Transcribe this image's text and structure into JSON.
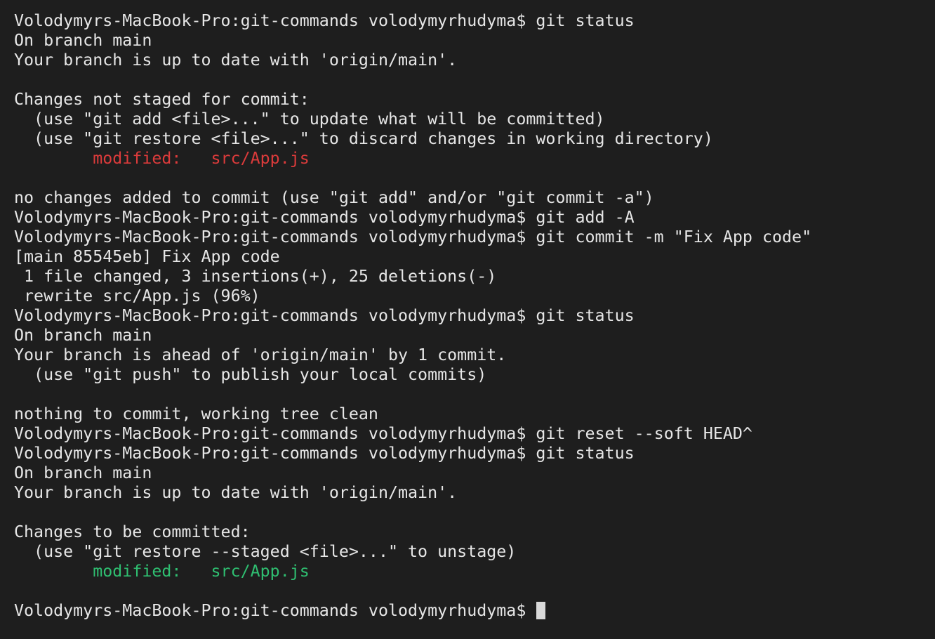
{
  "terminal": {
    "lines": [
      [
        {
          "text": "Volodymyrs-MacBook-Pro:git-commands volodymyrhudyma$ git status"
        }
      ],
      [
        {
          "text": "On branch main"
        }
      ],
      [
        {
          "text": "Your branch is up to date with 'origin/main'."
        }
      ],
      [
        {
          "text": ""
        }
      ],
      [
        {
          "text": "Changes not staged for commit:"
        }
      ],
      [
        {
          "text": "  (use \"git add <file>...\" to update what will be committed)"
        }
      ],
      [
        {
          "text": "  (use \"git restore <file>...\" to discard changes in working directory)"
        }
      ],
      [
        {
          "text": "        "
        },
        {
          "text": "modified:   src/App.js",
          "color": "red"
        }
      ],
      [
        {
          "text": ""
        }
      ],
      [
        {
          "text": "no changes added to commit (use \"git add\" and/or \"git commit -a\")"
        }
      ],
      [
        {
          "text": "Volodymyrs-MacBook-Pro:git-commands volodymyrhudyma$ git add -A"
        }
      ],
      [
        {
          "text": "Volodymyrs-MacBook-Pro:git-commands volodymyrhudyma$ git commit -m \"Fix App code\""
        }
      ],
      [
        {
          "text": "[main 85545eb] Fix App code"
        }
      ],
      [
        {
          "text": " 1 file changed, 3 insertions(+), 25 deletions(-)"
        }
      ],
      [
        {
          "text": " rewrite src/App.js (96%)"
        }
      ],
      [
        {
          "text": "Volodymyrs-MacBook-Pro:git-commands volodymyrhudyma$ git status"
        }
      ],
      [
        {
          "text": "On branch main"
        }
      ],
      [
        {
          "text": "Your branch is ahead of 'origin/main' by 1 commit."
        }
      ],
      [
        {
          "text": "  (use \"git push\" to publish your local commits)"
        }
      ],
      [
        {
          "text": ""
        }
      ],
      [
        {
          "text": "nothing to commit, working tree clean"
        }
      ],
      [
        {
          "text": "Volodymyrs-MacBook-Pro:git-commands volodymyrhudyma$ git reset --soft HEAD^"
        }
      ],
      [
        {
          "text": "Volodymyrs-MacBook-Pro:git-commands volodymyrhudyma$ git status"
        }
      ],
      [
        {
          "text": "On branch main"
        }
      ],
      [
        {
          "text": "Your branch is up to date with 'origin/main'."
        }
      ],
      [
        {
          "text": ""
        }
      ],
      [
        {
          "text": "Changes to be committed:"
        }
      ],
      [
        {
          "text": "  (use \"git restore --staged <file>...\" to unstage)"
        }
      ],
      [
        {
          "text": "        "
        },
        {
          "text": "modified:   src/App.js",
          "color": "green"
        }
      ],
      [
        {
          "text": ""
        }
      ]
    ],
    "prompt": "Volodymyrs-MacBook-Pro:git-commands volodymyrhudyma$ "
  },
  "colors": {
    "background": "#1e1e1e",
    "text": "#e6e6e6",
    "red": "#dc3b3b",
    "green": "#2fbf71",
    "cursor": "#d9d9d9"
  }
}
